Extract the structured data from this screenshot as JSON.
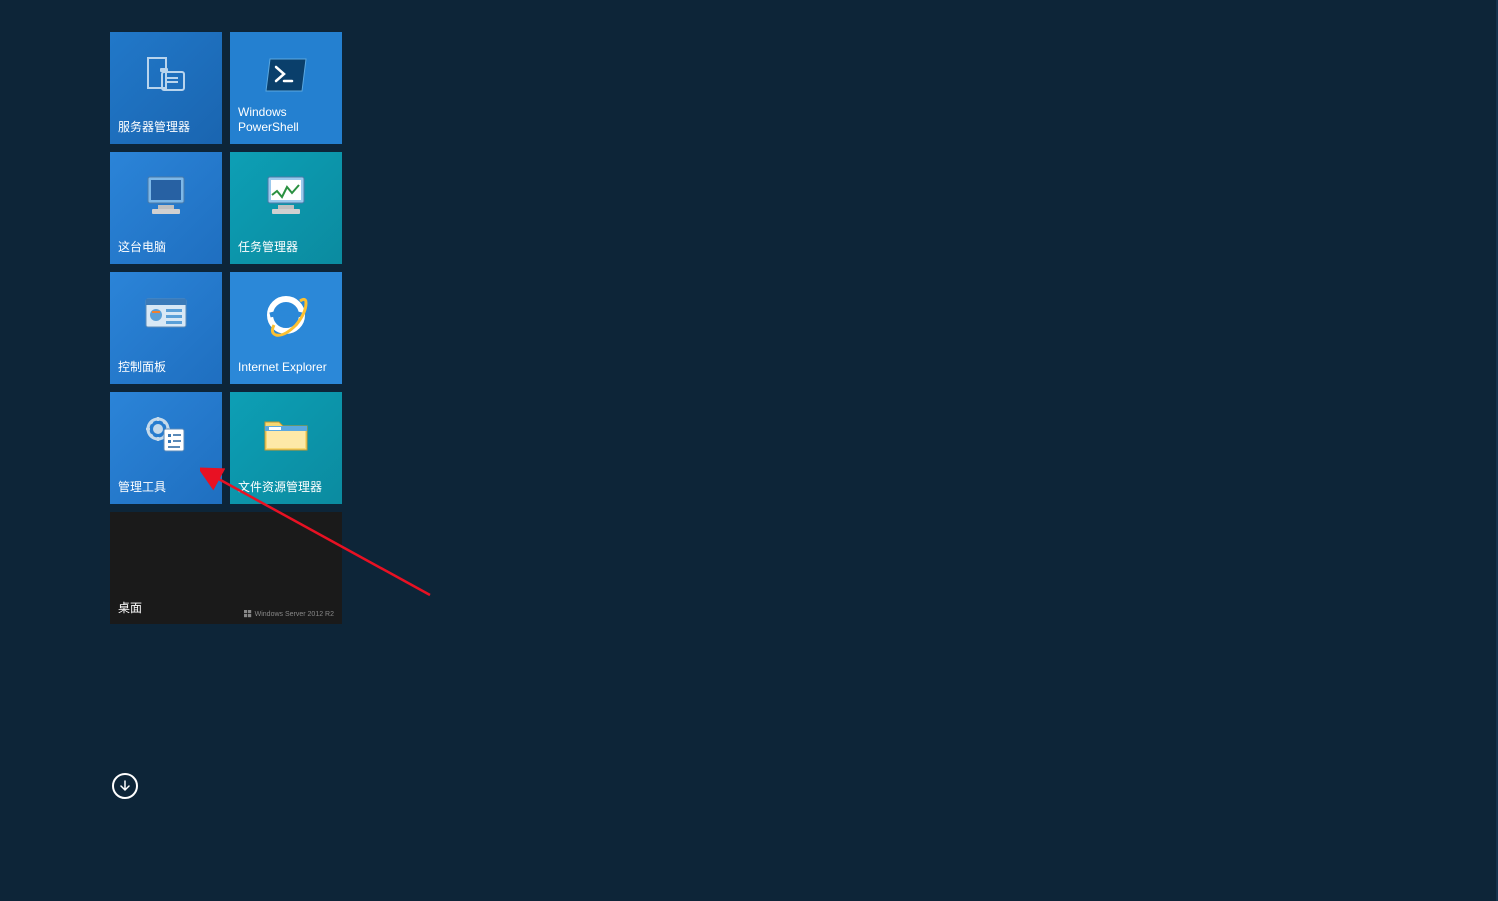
{
  "tiles": {
    "serverManager": {
      "label": "服务器管理器"
    },
    "powershell": {
      "label": "Windows PowerShell"
    },
    "thisPc": {
      "label": "这台电脑"
    },
    "taskManager": {
      "label": "任务管理器"
    },
    "controlPanel": {
      "label": "控制面板"
    },
    "internetExplorer": {
      "label": "Internet Explorer"
    },
    "adminTools": {
      "label": "管理工具"
    },
    "fileExplorer": {
      "label": "文件资源管理器"
    },
    "desktop": {
      "label": "桌面",
      "watermark": "Windows Server 2012 R2"
    }
  },
  "colors": {
    "background": "#0d2538",
    "tileBlue": "#2178c9",
    "tileTeal": "#0d9fb5",
    "arrowRed": "#e81123"
  }
}
